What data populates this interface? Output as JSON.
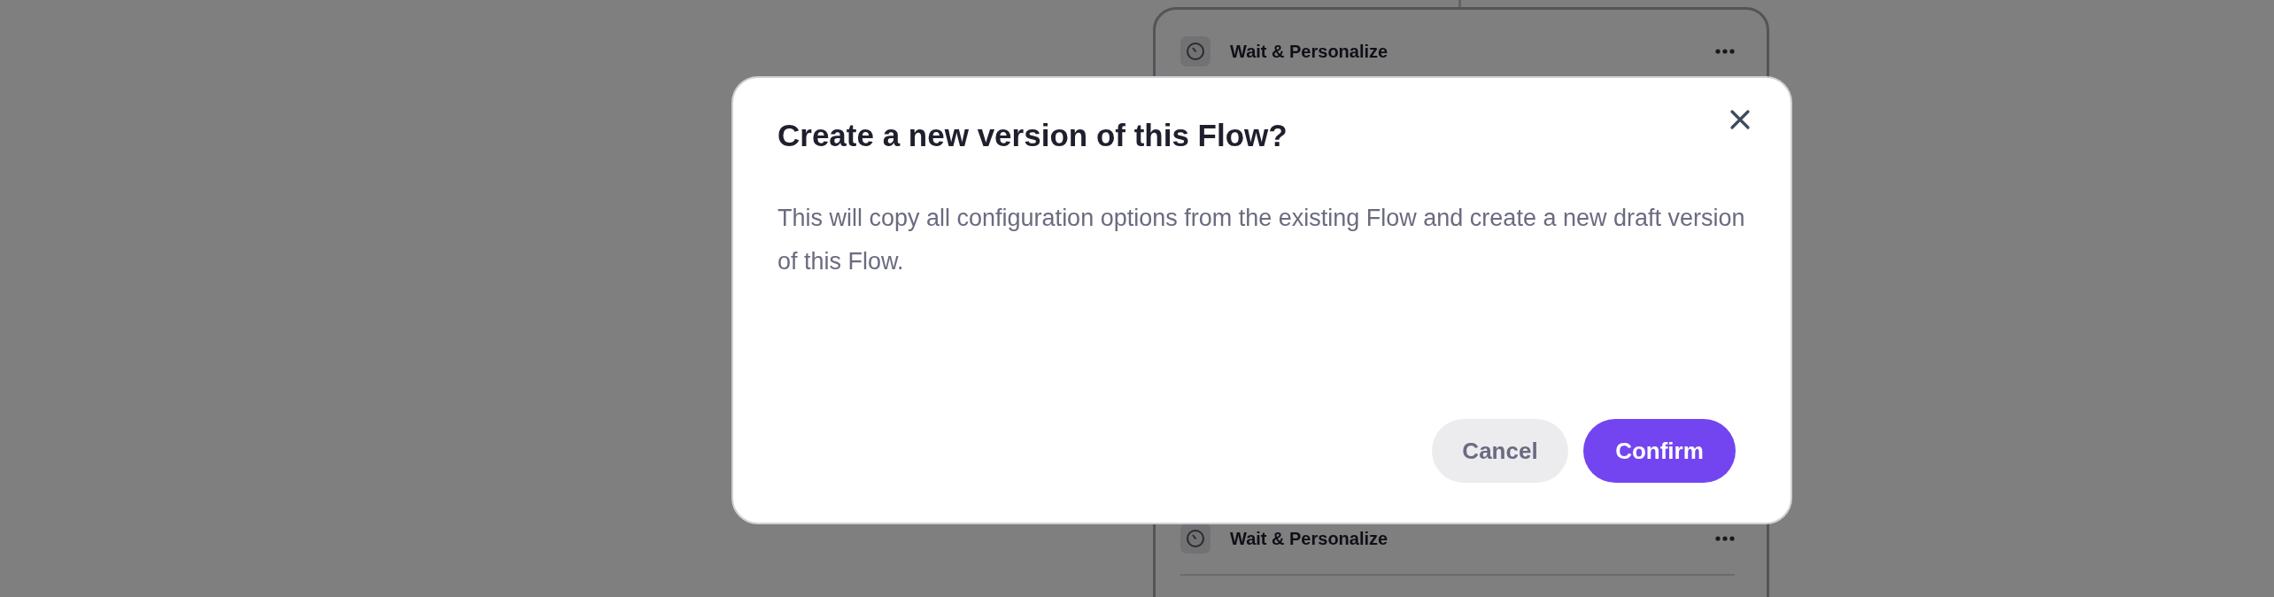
{
  "background_card": {
    "steps": [
      {
        "title": "Wait & Personalize"
      },
      {
        "title": "Wait & Personalize"
      }
    ]
  },
  "dialog": {
    "title": "Create a new version of this Flow?",
    "message": "This will copy all configuration options from the existing Flow and create a new draft version of this Flow.",
    "buttons": [
      {
        "label": "Cancel",
        "kind": "secondary"
      },
      {
        "label": "Confirm",
        "kind": "primary"
      }
    ]
  }
}
